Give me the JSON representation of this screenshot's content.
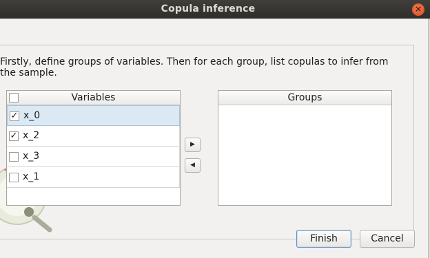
{
  "window": {
    "title": "Copula inference",
    "close_icon": "×"
  },
  "intro_text": "Firstly, define groups of variables. Then for each group, list copulas to infer from the sample.",
  "variables_table": {
    "header": "Variables",
    "rows": [
      {
        "label": "x_0",
        "checked": "✓",
        "selected": true
      },
      {
        "label": "x_2",
        "checked": "✓",
        "selected": false
      },
      {
        "label": "x_3",
        "checked": "",
        "selected": false
      },
      {
        "label": "x_1",
        "checked": "",
        "selected": false
      }
    ]
  },
  "groups_table": {
    "header": "Groups"
  },
  "buttons": {
    "add_arrow": "▶",
    "remove_arrow": "◀",
    "finish": "Finish",
    "cancel": "Cancel"
  },
  "colors": {
    "titlebar": "#3f3e3a",
    "close": "#e25a2a",
    "selection": "#dbe9f4",
    "dialog_bg": "#f2f1f0"
  }
}
